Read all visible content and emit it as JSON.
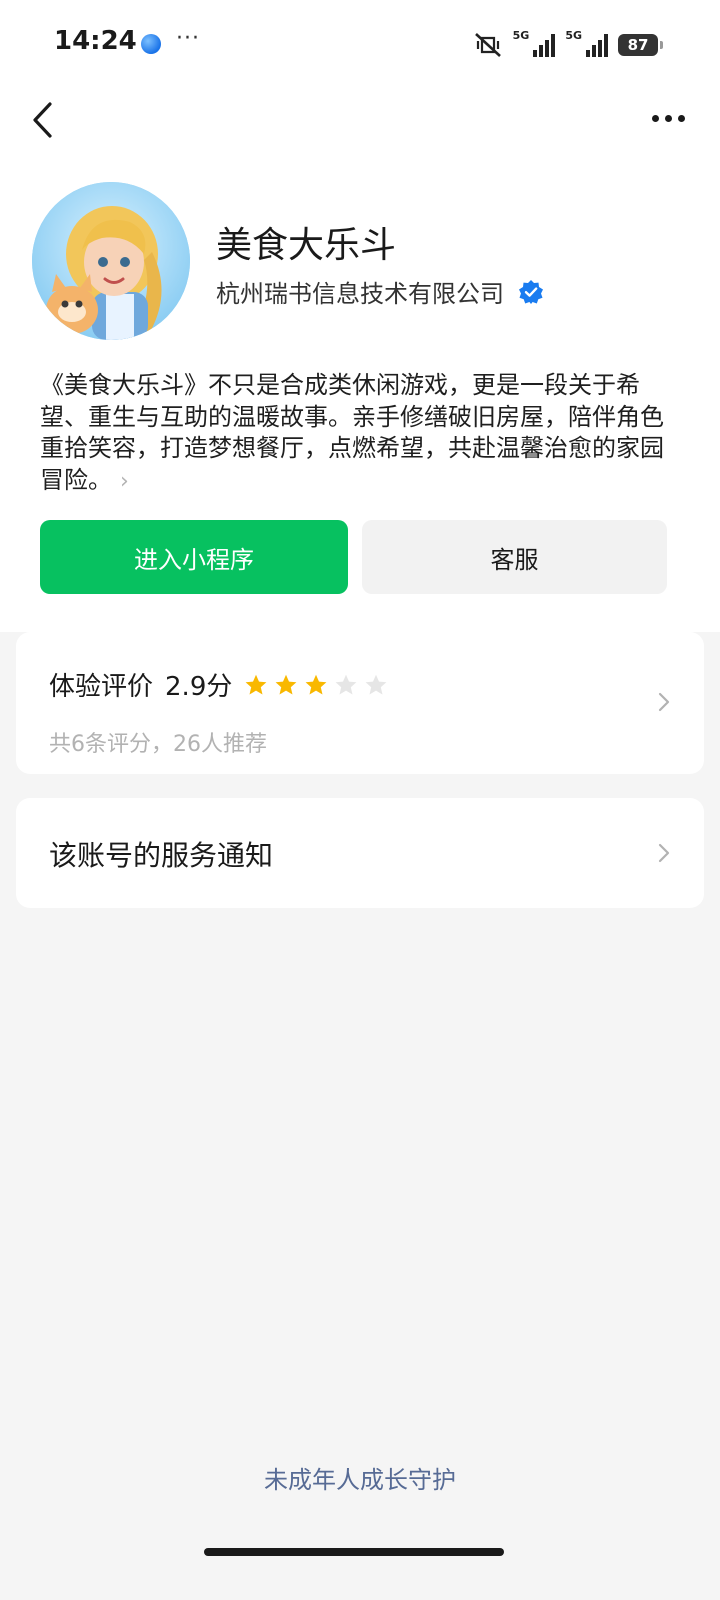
{
  "status_bar": {
    "time": "14:24",
    "dots": "···",
    "network_1": "5G",
    "network_2": "5G",
    "battery": "87"
  },
  "nav": {
    "back_icon": "chevron-left-icon",
    "more_icon": "more-horizontal-icon"
  },
  "profile": {
    "name": "美食大乐斗",
    "company": "杭州瑞书信息技术有限公司",
    "verified_icon": "verified-badge-icon",
    "description": "《美食大乐斗》不只是合成类休闲游戏，更是一段关于希望、重生与互助的温暖故事。亲手修缮破旧房屋，陪伴角色重拾笑容，打造梦想餐厅，点燃希望，共赴温馨治愈的家园冒险。"
  },
  "actions": {
    "primary_label": "进入小程序",
    "secondary_label": "客服"
  },
  "rating": {
    "title": "体验评价",
    "score": "2.9分",
    "stars_filled": 3,
    "stars_total": 5,
    "summary": "共6条评分，26人推荐"
  },
  "notice": {
    "title": "该账号的服务通知"
  },
  "footer": {
    "link": "未成年人成长守护"
  },
  "colors": {
    "primary_green": "#07c160",
    "star_gold": "#f9b800",
    "link_blue": "#576b95",
    "verified_blue": "#1a7cf0"
  }
}
